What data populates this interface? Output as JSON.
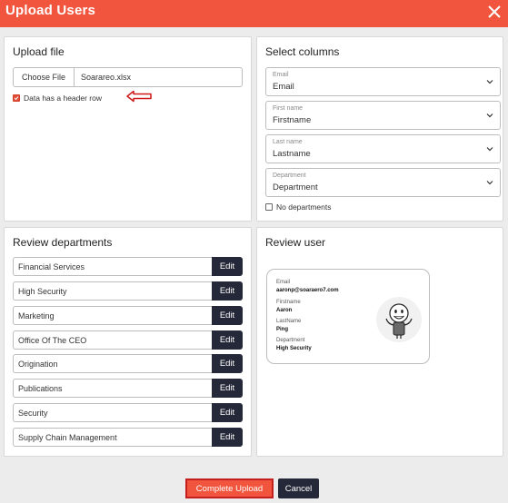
{
  "dialog": {
    "title": "Upload Users"
  },
  "upload": {
    "title": "Upload file",
    "choose_label": "Choose File",
    "file_name": "Soarareo.xlsx",
    "header_row_label": "Data has a header row",
    "header_row_checked": true
  },
  "columns": {
    "title": "Select columns",
    "fields": [
      {
        "label": "Email",
        "value": "Email"
      },
      {
        "label": "First name",
        "value": "Firstname"
      },
      {
        "label": "Last name",
        "value": "Lastname"
      },
      {
        "label": "Department",
        "value": "Department"
      }
    ],
    "no_departments_label": "No departments",
    "no_departments_checked": false
  },
  "departments": {
    "title": "Review departments",
    "edit_label": "Edit",
    "items": [
      "Financial Services",
      "High Security",
      "Marketing",
      "Office Of The CEO",
      "Origination",
      "Publications",
      "Security",
      "Supply Chain Management"
    ]
  },
  "review": {
    "title": "Review user",
    "email_label": "Email",
    "email_value": "aaronp@soaraero7.com",
    "firstname_label": "Firstname",
    "firstname_value": "Aaron",
    "lastname_label": "LastName",
    "lastname_value": "Ping",
    "department_label": "Department",
    "department_value": "High Security"
  },
  "footer": {
    "complete_label": "Complete Upload",
    "cancel_label": "Cancel"
  },
  "colors": {
    "accent": "#f2553d",
    "dark_button": "#252838",
    "highlight_border": "#c41e1e"
  }
}
